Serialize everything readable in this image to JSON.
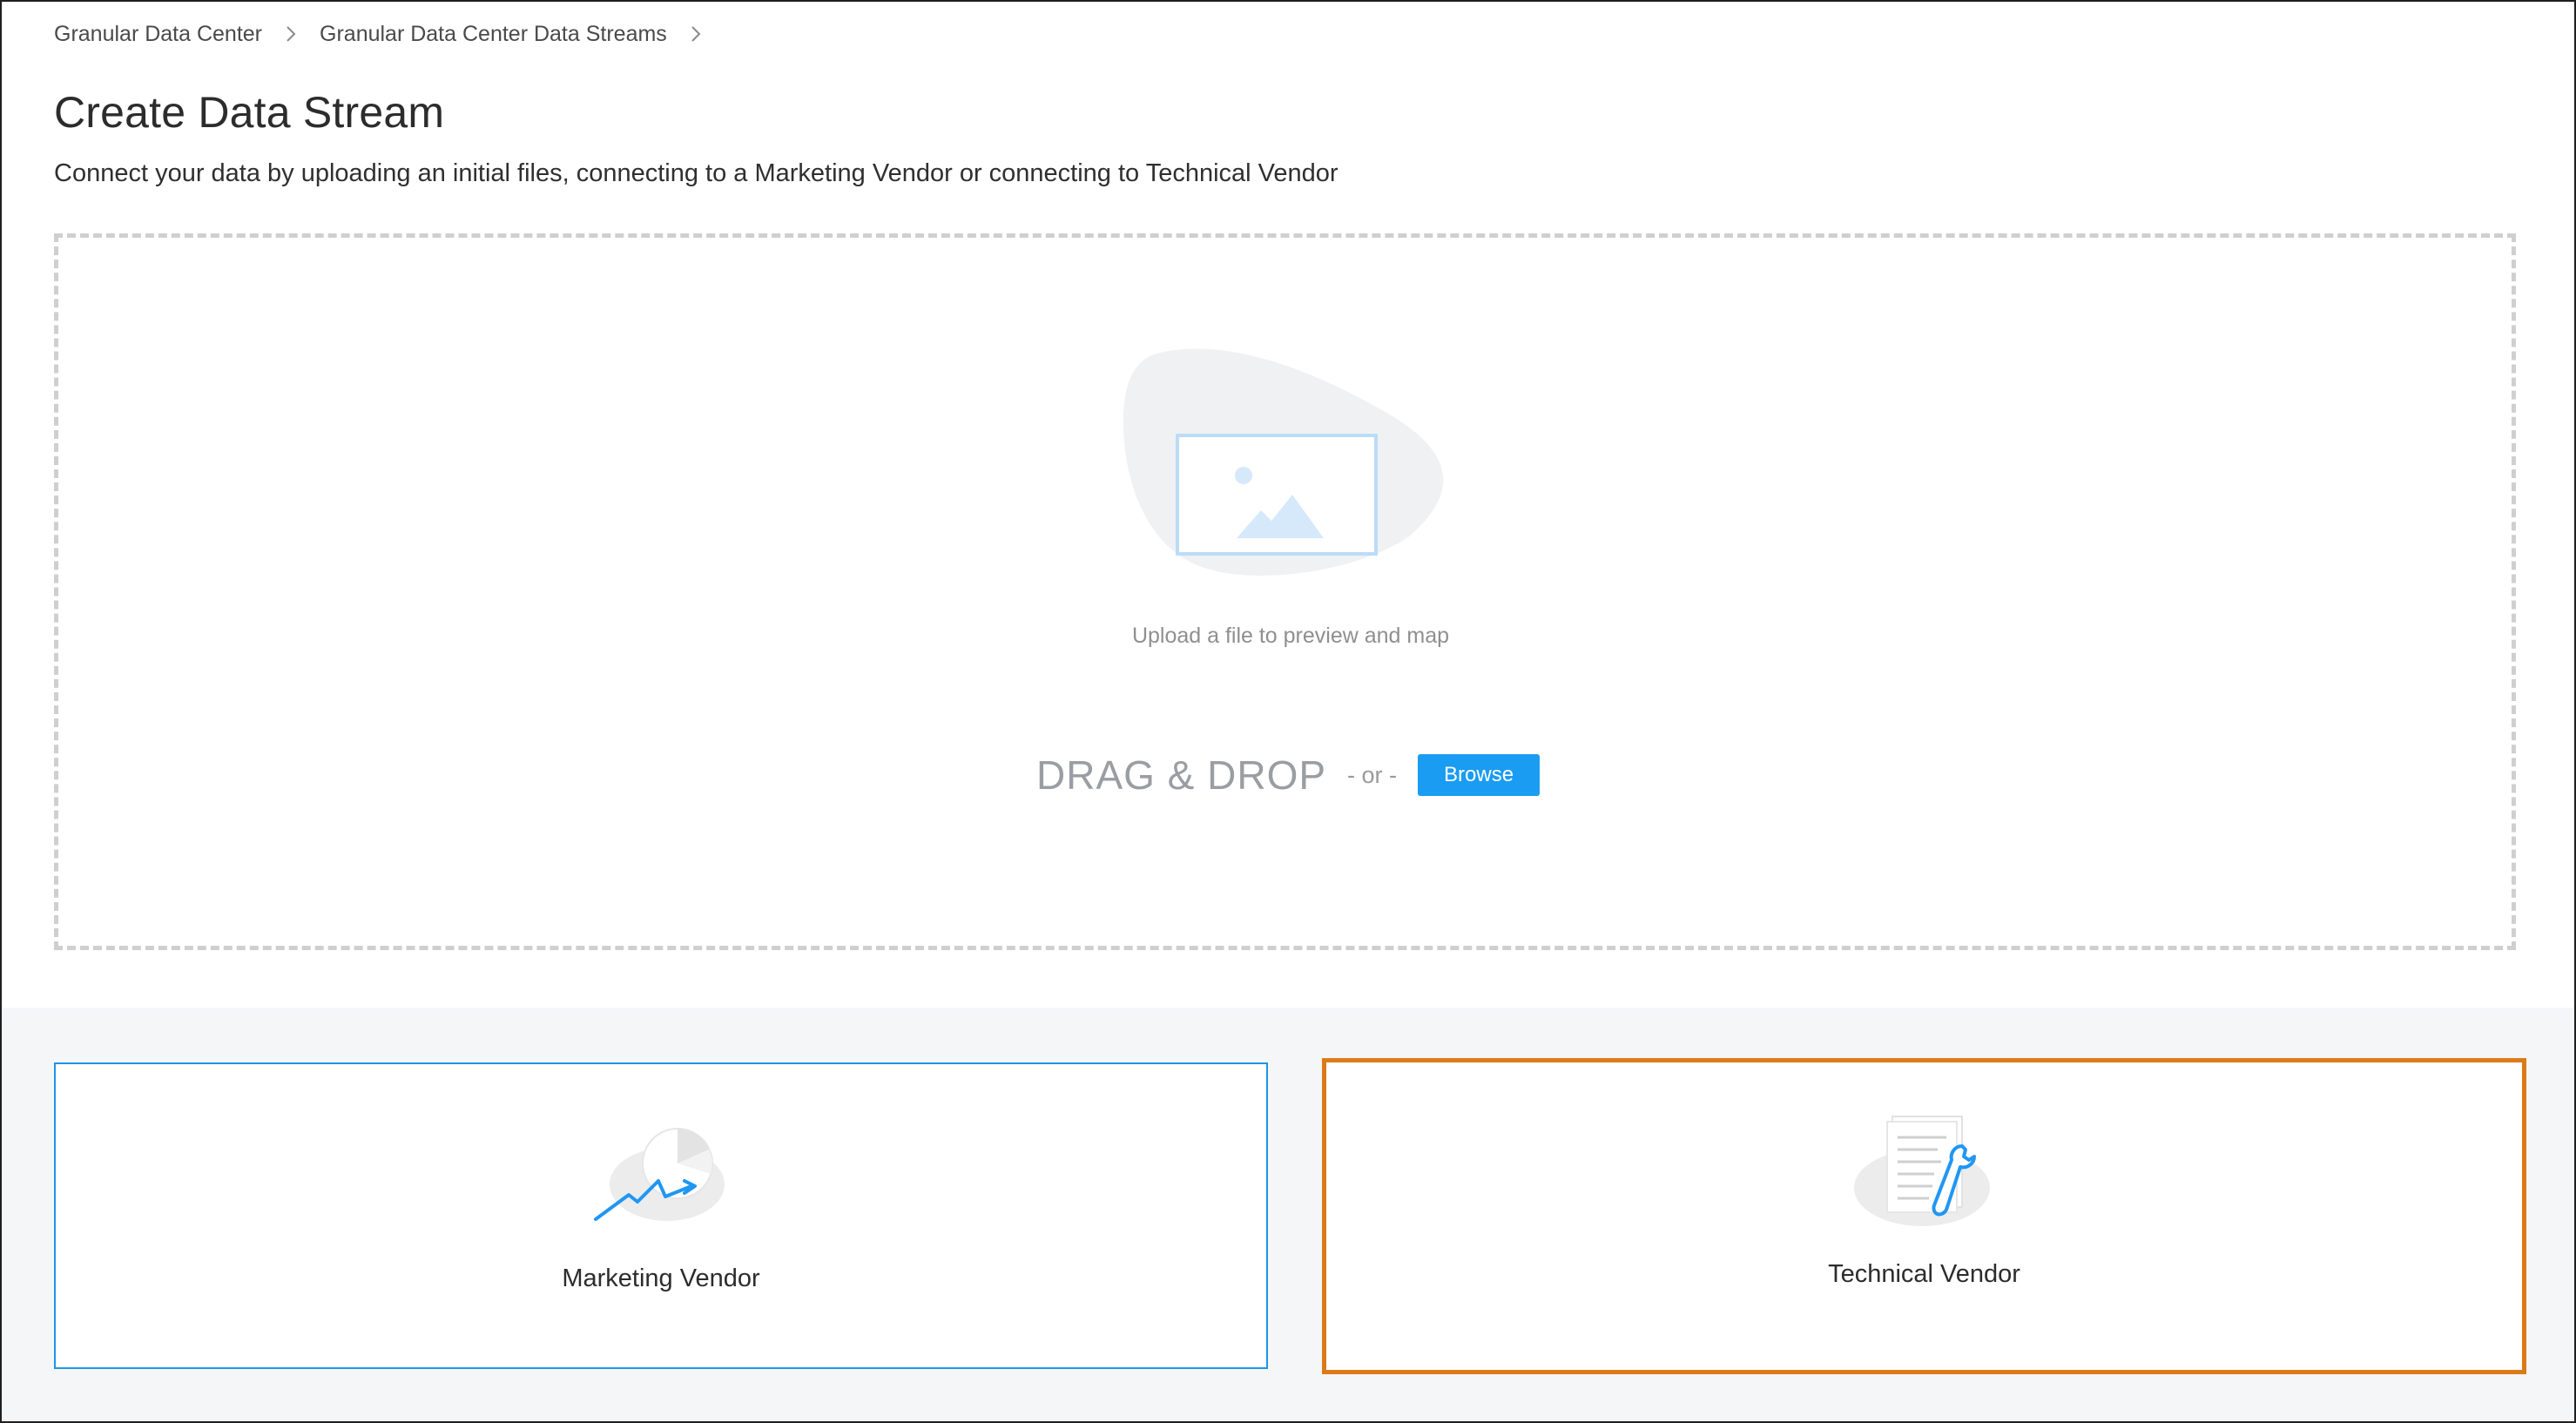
{
  "breadcrumb": {
    "items": [
      {
        "label": "Granular Data Center"
      },
      {
        "label": "Granular Data Center Data Streams"
      }
    ]
  },
  "page": {
    "title": "Create Data Stream",
    "subtitle": "Connect your data by uploading an initial files, connecting to a Marketing Vendor or connecting to Technical Vendor"
  },
  "upload": {
    "hint": "Upload a file to preview and map",
    "drag_drop_label": "DRAG & DROP",
    "or_label": "- or -",
    "browse_label": "Browse",
    "illustration_icon": "image-placeholder-icon"
  },
  "vendors": [
    {
      "label": "Marketing Vendor",
      "icon": "marketing-chart-icon",
      "state": "default"
    },
    {
      "label": "Technical Vendor",
      "icon": "technical-document-wrench-icon",
      "state": "highlighted"
    }
  ],
  "colors": {
    "accent": "#1a9cf2",
    "highlight_border": "#dc7a18",
    "dropzone_border": "#cfcfcf",
    "band_background": "#f4f6f8"
  }
}
